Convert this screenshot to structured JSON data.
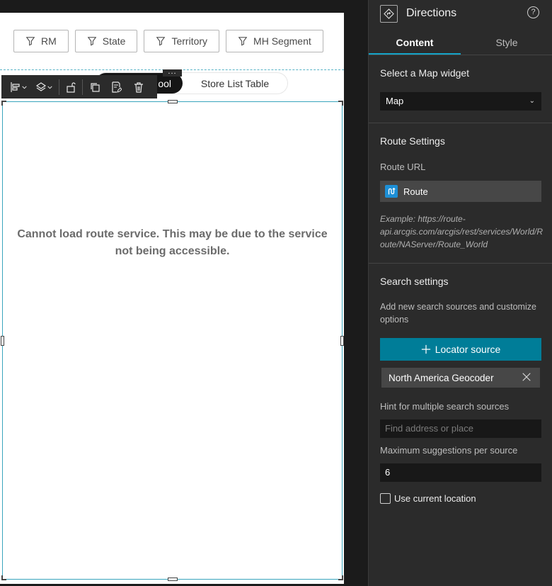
{
  "canvas": {
    "filters": [
      {
        "label": "RM"
      },
      {
        "label": "State"
      },
      {
        "label": "Territory"
      },
      {
        "label": "MH Segment"
      }
    ],
    "tabs": {
      "active_partial": "ool",
      "inactive": "Store List Table"
    },
    "toolbar_more": "...",
    "widget_error": "Cannot load route service. This may be due to the service not being accessible."
  },
  "panel": {
    "title": "Directions",
    "help": "?",
    "tabs": [
      {
        "label": "Content",
        "active": true
      },
      {
        "label": "Style",
        "active": false
      }
    ],
    "map_section": {
      "title": "Select a Map widget",
      "selected": "Map"
    },
    "route_section": {
      "title": "Route Settings",
      "url_label": "Route URL",
      "route_name": "Route",
      "example": "Example: https://route-api.arcgis.com/arcgis/rest/services/World/Route/NAServer/Route_World"
    },
    "search_section": {
      "title": "Search settings",
      "description": "Add new search sources and customize options",
      "add_button": "Locator source",
      "source_chip": "North America Geocoder",
      "hint_label": "Hint for multiple search sources",
      "hint_placeholder": "Find address or place",
      "max_label": "Maximum suggestions per source",
      "max_value": "6",
      "current_location_label": "Use current location"
    }
  },
  "colors": {
    "accent": "#007d98",
    "tab_underline": "#14a3c7",
    "selection": "#3aa5bd"
  }
}
